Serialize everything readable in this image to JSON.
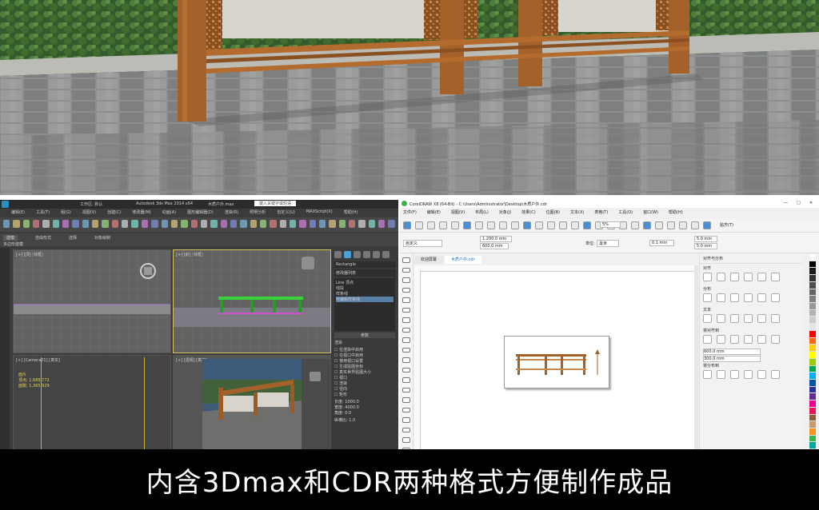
{
  "caption": "内含3Dmax和CDR两种格式方便制作成品",
  "max": {
    "title_segments": [
      "工作区: 默认",
      "Autodesk 3ds Max 2014 x64",
      "木质户外.max",
      "键入关键字或短语"
    ],
    "menu": [
      "编辑(E)",
      "工具(T)",
      "组(G)",
      "视图(V)",
      "创建(C)",
      "修改器(M)",
      "动画(A)",
      "图形编辑器(D)",
      "渲染(R)",
      "照明分析",
      "自定义(U)",
      "MAXScript(X)",
      "帮助(H)"
    ],
    "ribbon_tabs": [
      "建模",
      "自由形式",
      "选择",
      "对象绘制"
    ],
    "ribbon_sub": "多边形建模",
    "viewports": [
      {
        "label": "[+] [顶] [线框]"
      },
      {
        "label": "[+] [前] [线框]"
      },
      {
        "label": "[+] [Camera01] [真实]"
      },
      {
        "label": "[+] [透视] [真实]"
      }
    ],
    "camera_readout": [
      "面片",
      "顶点: 1,688,772",
      "面数: 1,365,929"
    ],
    "right_panel": {
      "obj_name": "Rectangle",
      "modifier_list": "修改器列表",
      "items": [
        "Line 顶点",
        "线段",
        "样条线",
        "可编辑样条线"
      ],
      "params_header": "参数",
      "render_header": "渲染",
      "options": [
        "在渲染中启用",
        "在视口中启用",
        "使用视口设置",
        "生成贴图坐标",
        "真实世界贴图大小",
        "视口",
        "渲染",
        "径向",
        "矩形"
      ],
      "fields": [
        {
          "label": "长度",
          "value": "1000.0"
        },
        {
          "label": "宽度",
          "value": "4000.0"
        },
        {
          "label": "角度",
          "value": "0.0"
        }
      ],
      "aspect": "纵横比: 1.0"
    }
  },
  "cdr": {
    "title": "CorelDRAW X8 (64-Bit) - C:\\Users\\Administrator\\Desktop\\木质户外.cdr",
    "menu": [
      "文件(F)",
      "编辑(E)",
      "视图(V)",
      "布局(L)",
      "对象(J)",
      "效果(C)",
      "位图(B)",
      "文本(X)",
      "表格(T)",
      "工具(O)",
      "窗口(W)",
      "帮助(H)"
    ],
    "zoom": "5%",
    "snap": "贴齐(T)",
    "page_preset": "自定义",
    "width": "1,200.0 mm",
    "height": "600.0 mm",
    "units_label": "单位:",
    "units": "毫米",
    "nudge": "0.1 mm",
    "dup_x": "5.0 mm",
    "dup_y": "5.0 mm",
    "tabs": [
      "欢迎屏幕",
      "木质户外.cdr"
    ],
    "docker_title": "对齐与分布",
    "docker_sections": [
      "对齐",
      "分布",
      "文本",
      "将对齐到",
      "将分布到"
    ],
    "docker_fields": [
      "600.0 mm",
      "300.0 mm"
    ]
  },
  "colors": {
    "wood": "#a4622a",
    "pavement": "#8a8c8c",
    "hedge": "#3f6b2e",
    "max_bg": "#3b3b3b",
    "max_selected": "#d7c25a",
    "cdr_bg": "#f0f0f0"
  }
}
